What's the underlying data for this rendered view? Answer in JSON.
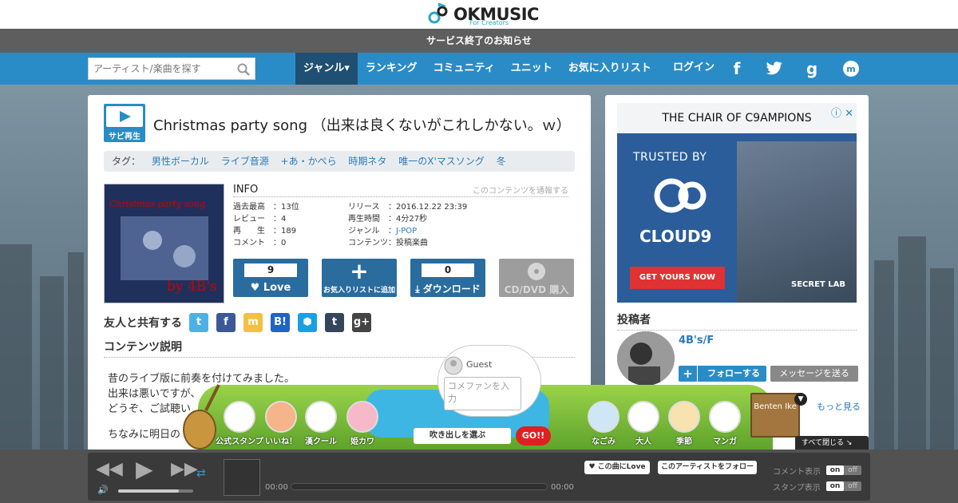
{
  "logo": {
    "name": "OKMUSIC",
    "sub": "For Creators"
  },
  "notice": "サービス終了のお知らせ",
  "nav": {
    "search_placeholder": "アーティスト/楽曲を探す",
    "menu": [
      "ジャンル▾",
      "ランキング",
      "コミュニティ",
      "ユニット",
      "お気に入りリスト"
    ],
    "login": "ログイン"
  },
  "song": {
    "sabi_label": "サビ再生",
    "title": "Christmas party song （出来は良くないがこれしかない。ｗ）",
    "tags_label": "タグ：",
    "tags": [
      "男性ボーカル",
      "ライブ音源",
      "+あ・かぺら",
      "時期ネタ",
      "唯一のX'マスソング",
      "冬"
    ],
    "jacket_text_top": "Christmas party song",
    "jacket_text_bottom": "by 4B's",
    "info_title": "INFO",
    "report": "このコンテンツを通報する",
    "info_left": [
      {
        "k": "過去最高",
        "v": "13位"
      },
      {
        "k": "レビュー",
        "v": "4"
      },
      {
        "k": "再　　生",
        "v": "189"
      },
      {
        "k": "コメント",
        "v": "0"
      }
    ],
    "info_right": [
      {
        "k": "リリース",
        "v": "2016.12.22 23:39"
      },
      {
        "k": "再生時間",
        "v": "4分27秒"
      },
      {
        "k": "ジャンル",
        "v": "J-POP"
      },
      {
        "k": "コンテンツ",
        "v": "投稿楽曲"
      }
    ],
    "love_count": "9",
    "love_label": "Love",
    "fav_label": "お気入りリストに追加",
    "dl_count": "0",
    "dl_label": "ダウンロード",
    "cd_label": "CD/DVD 購入",
    "share_label": "友人と共有する",
    "desc_title": "コンテンツ説明",
    "desc_lines": [
      "昔のライブ版に前奏を付けてみました。",
      "出来は悪いですが、",
      "どうぞ、ご試聴い",
      "ちなみに明日の"
    ]
  },
  "ad": {
    "top": "THE CHAIR OF C9AMPIONS",
    "trusted": "TRUSTED BY",
    "brand": "CLOUD9",
    "cta": "GET YOURS NOW",
    "maker": "SECRET LAB"
  },
  "poster": {
    "title": "投稿者",
    "name": "4B's/F",
    "follow": "フォローする",
    "message": "メッセージを送る",
    "more": "もっと見る"
  },
  "stamps": {
    "guest": "Guest",
    "comment_placeholder": "コメファンを入力",
    "fukidashi": "吹き出しを選ぶ",
    "go": "GO!!",
    "labels_left": [
      "公式スタンプ",
      "いいね！",
      "漢クール",
      "姫カワ"
    ],
    "labels_right": [
      "なごみ",
      "大人",
      "季節",
      "マンガ"
    ],
    "benten": "Benten Ike",
    "close_all": "すべて閉じる"
  },
  "player": {
    "time_start": "00:00",
    "time_end": "00:00",
    "love_song": "この曲にLove",
    "follow_artist": "このアーティストをフォロー",
    "comment_toggle": "コメント表示",
    "stamp_toggle": "スタンプ表示",
    "on": "on",
    "off": "off"
  }
}
